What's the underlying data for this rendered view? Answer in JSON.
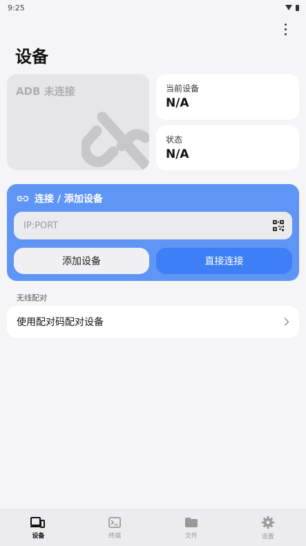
{
  "status_bar": {
    "time": "9:25"
  },
  "header": {
    "title": "设备"
  },
  "adb_card": {
    "label": "ADB 未连接"
  },
  "device_card": {
    "caption": "当前设备",
    "value": "N/A"
  },
  "status_card": {
    "caption": "状态",
    "value": "N/A"
  },
  "connect_panel": {
    "title": "连接 / 添加设备",
    "address_placeholder": "IP:PORT",
    "address_value": "",
    "add_button": "添加设备",
    "direct_button": "直接连接"
  },
  "wireless": {
    "section_title": "无线配对",
    "pair_item": "使用配对码配对设备"
  },
  "bottom_nav": {
    "items": [
      {
        "label": "设备",
        "icon": "device-icon",
        "active": true
      },
      {
        "label": "终端",
        "icon": "terminal-icon",
        "active": false
      },
      {
        "label": "文件",
        "icon": "folder-icon",
        "active": false
      },
      {
        "label": "设置",
        "icon": "gear-icon",
        "active": false
      }
    ]
  },
  "colors": {
    "accent": "#3f7ff5",
    "panel": "#5f95f5",
    "background": "#f5f5f7"
  }
}
